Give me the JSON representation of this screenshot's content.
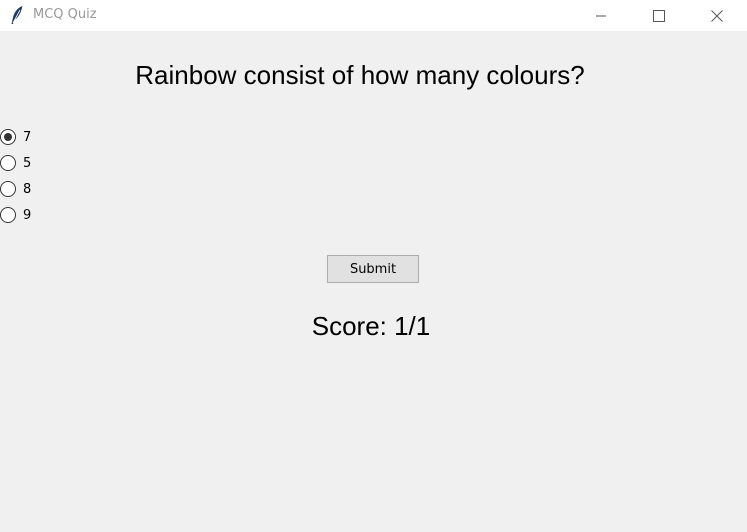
{
  "window": {
    "title": "MCQ Quiz",
    "icon": "feather-icon"
  },
  "question": "Rainbow consist of how many colours?",
  "options": [
    {
      "label": "7",
      "selected": true
    },
    {
      "label": "5",
      "selected": false
    },
    {
      "label": "8",
      "selected": false
    },
    {
      "label": "9",
      "selected": false
    }
  ],
  "submit_label": "Submit",
  "score": "Score: 1/1"
}
